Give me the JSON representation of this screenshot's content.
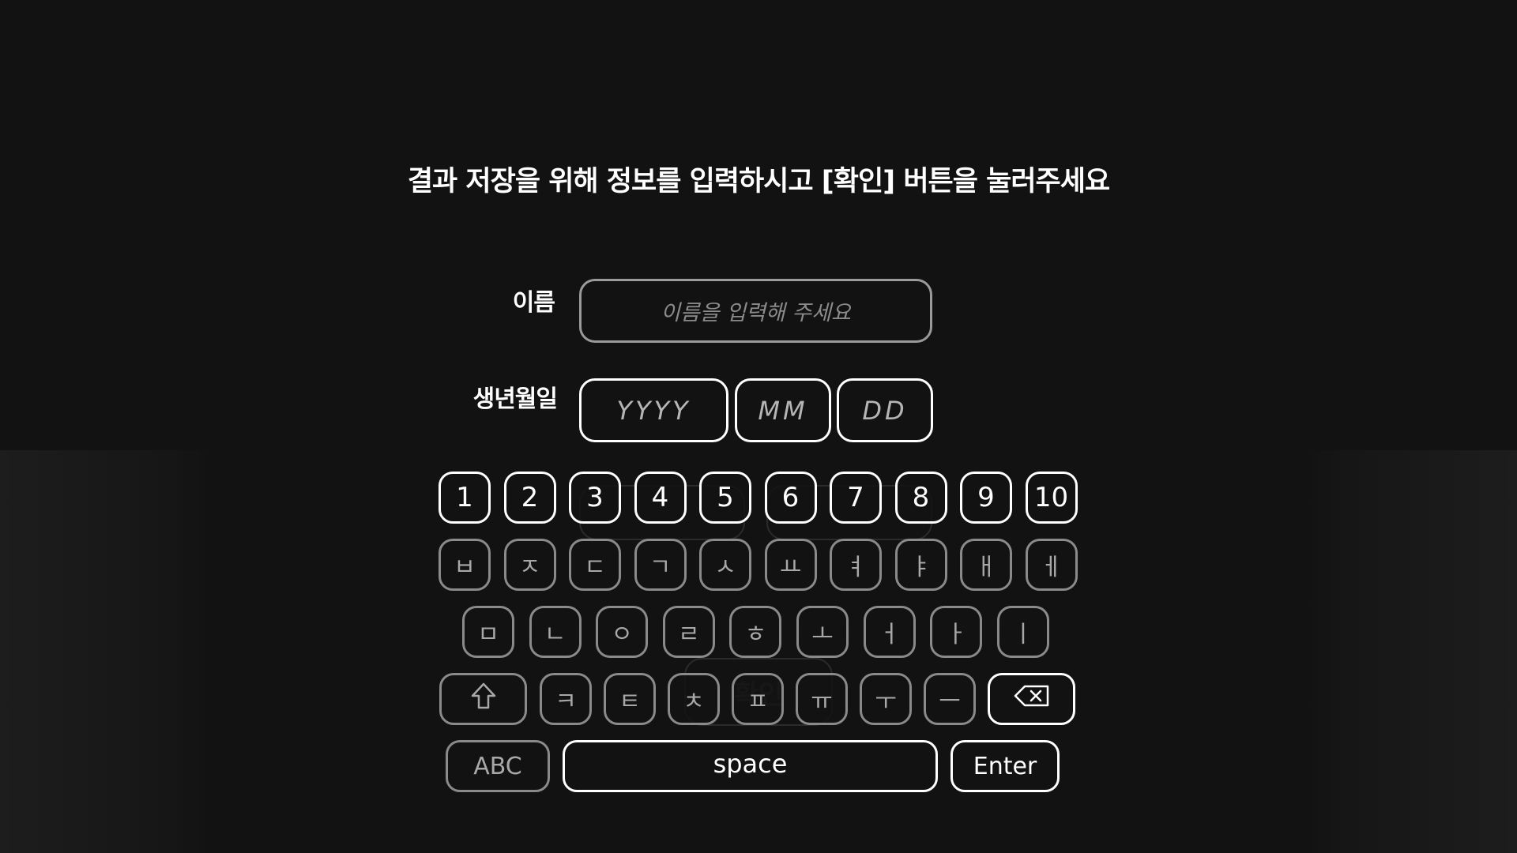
{
  "instruction": "결과 저장을 위해 정보를 입력하시고 [확인] 버튼을 눌러주세요",
  "form": {
    "name_label": "이름",
    "name_placeholder": "이름을 입력해 주세요",
    "birth_label": "생년월일",
    "year_placeholder": "YYYY",
    "month_placeholder": "MM",
    "day_placeholder": "DD"
  },
  "ghost": {
    "confirm_label": "확인"
  },
  "keyboard": {
    "numbers": [
      "1",
      "2",
      "3",
      "4",
      "5",
      "6",
      "7",
      "8",
      "9",
      "10"
    ],
    "row1": [
      "ㅂ",
      "ㅈ",
      "ㄷ",
      "ㄱ",
      "ㅅ",
      "ㅛ",
      "ㅕ",
      "ㅑ",
      "ㅐ",
      "ㅔ"
    ],
    "row2": [
      "ㅁ",
      "ㄴ",
      "ㅇ",
      "ㄹ",
      "ㅎ",
      "ㅗ",
      "ㅓ",
      "ㅏ",
      "ㅣ"
    ],
    "row3": [
      "ㅋ",
      "ㅌ",
      "ㅊ",
      "ㅍ",
      "ㅠ",
      "ㅜ",
      "ㅡ"
    ],
    "shift_icon": "shift-arrow-icon",
    "backspace_icon": "backspace-icon",
    "abc_label": "ABC",
    "space_label": "space",
    "enter_label": "Enter"
  }
}
